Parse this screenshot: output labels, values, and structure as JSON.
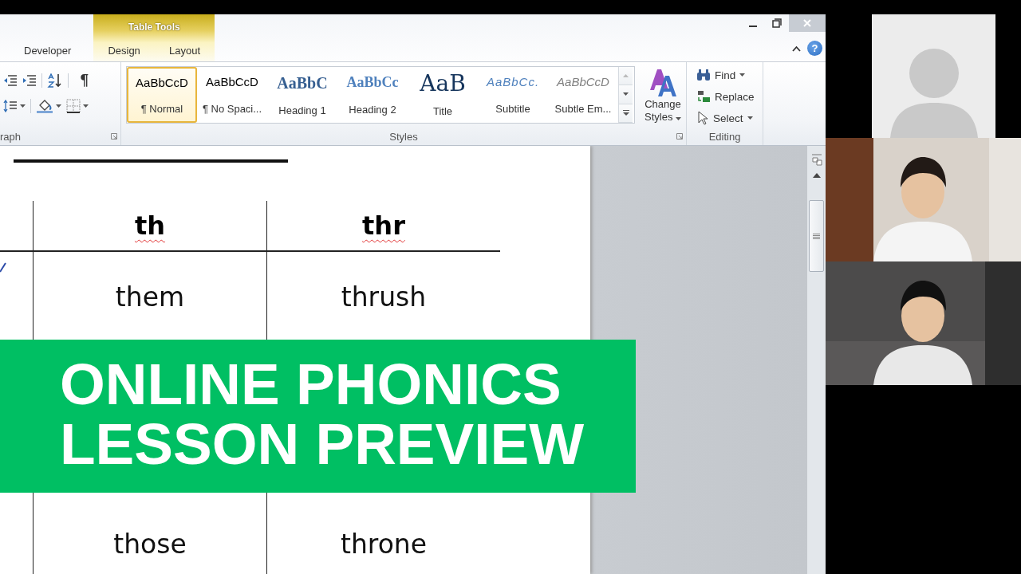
{
  "window": {
    "tabs": [
      {
        "label": "Developer",
        "selected": false
      }
    ],
    "contextual_group": {
      "label": "Table Tools",
      "tabs": [
        {
          "label": "Design",
          "selected": false
        },
        {
          "label": "Layout",
          "selected": false
        }
      ]
    },
    "help_button": "?"
  },
  "ribbon": {
    "paragraph_group": {
      "label": "raph",
      "show_marks_button": "¶"
    },
    "styles_group": {
      "label": "Styles",
      "styles": [
        {
          "preview": "AaBbCcD",
          "label": "¶ Normal",
          "kind": "normal",
          "selected": true
        },
        {
          "preview": "AaBbCcD",
          "label": "¶ No Spaci...",
          "kind": "normal",
          "selected": false
        },
        {
          "preview": "AaBbC",
          "label": "Heading 1",
          "kind": "heading1",
          "selected": false
        },
        {
          "preview": "AaBbCc",
          "label": "Heading 2",
          "kind": "heading2",
          "selected": false
        },
        {
          "preview": "AaB",
          "label": "Title",
          "kind": "title",
          "selected": false
        },
        {
          "preview": "AaBbCc.",
          "label": "Subtitle",
          "kind": "subtitle",
          "selected": false
        },
        {
          "preview": "AaBbCcD",
          "label": "Subtle Em...",
          "kind": "emphasis",
          "selected": false
        }
      ],
      "change_styles": {
        "label": "Change Styles",
        "dropdown": true
      }
    },
    "editing_group": {
      "label": "Editing",
      "commands": [
        {
          "label": "Find",
          "kind": "find",
          "dropdown": true
        },
        {
          "label": "Replace",
          "kind": "replace",
          "dropdown": false
        },
        {
          "label": "Select",
          "kind": "select",
          "dropdown": true
        }
      ]
    }
  },
  "document": {
    "table": {
      "headings": [
        {
          "text": "th",
          "misspelled": true
        },
        {
          "text": "thr",
          "misspelled": true
        }
      ],
      "rows": [
        [
          "them",
          "thrush"
        ],
        [
          "those",
          "throne"
        ]
      ]
    }
  },
  "banner": {
    "title": "ONLINE PHONICS LESSON PREVIEW"
  },
  "participants": [
    {
      "kind": "avatar"
    },
    {
      "kind": "picture"
    },
    {
      "kind": "picture"
    }
  ]
}
